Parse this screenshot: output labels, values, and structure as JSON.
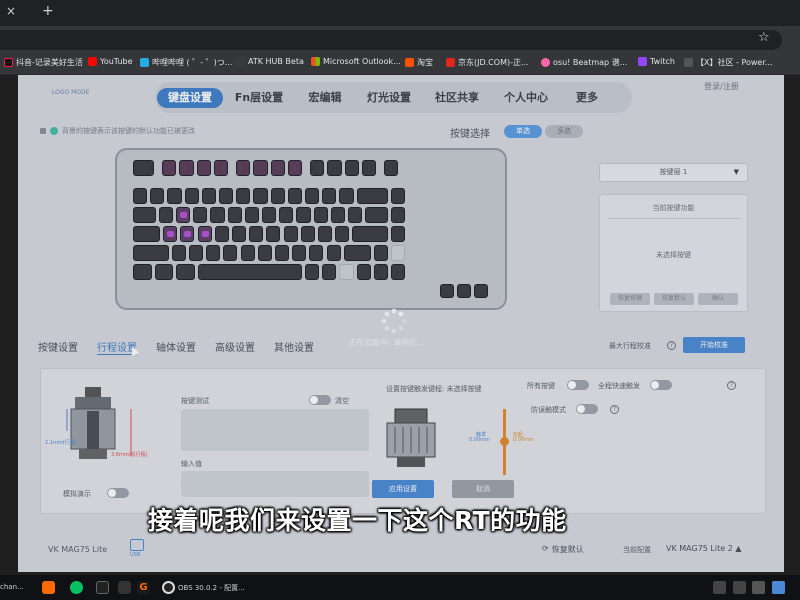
{
  "browser": {
    "tab_close": "×",
    "tab_new": "+",
    "star": "☆",
    "bookmarks": [
      {
        "label": "抖音-记录美好生活",
        "color": "#111111"
      },
      {
        "label": "YouTube",
        "color": "#ff0000"
      },
      {
        "label": "哔哩哔哩 ( ゜- ゜)つ...",
        "color": "#23ade5"
      },
      {
        "label": "ATK HUB Beta",
        "color": "#3a3a3a"
      },
      {
        "label": "Microsoft Outlook...",
        "color": "#f25022"
      },
      {
        "label": "淘宝",
        "color": "#ff5000"
      },
      {
        "label": "京东(JD.COM)-正...",
        "color": "#e1251b"
      },
      {
        "label": "osu! Beatmap 谱...",
        "color": "#ff66aa"
      },
      {
        "label": "Twitch",
        "color": "#9146ff"
      },
      {
        "label": "【X】社区 - Power...",
        "color": "#555555"
      }
    ]
  },
  "site": {
    "logo": "LOGO MODE",
    "nav": [
      "键盘设置",
      "Fn层设置",
      "宏编辑",
      "灯光设置",
      "社区共享",
      "个人中心",
      "更多"
    ],
    "login": "登录/注册",
    "tip": "背景的按键表示该按键的默认功能已被更改",
    "key_select": {
      "label": "按键选择",
      "on": "单选",
      "off": "多选"
    },
    "layer_select": "按键层 1",
    "fn_panel": {
      "title": "当前按键功能",
      "empty": "未选择按键",
      "buttons": [
        "恢复按键",
        "恢复默认",
        "确认"
      ]
    },
    "loading": "正在加载中, 请稍后...",
    "subtabs": [
      "按键设置",
      "行程设置",
      "轴体设置",
      "高级设置",
      "其他设置"
    ],
    "calibrate": {
      "label": "最大行程校准",
      "button": "开始校准"
    },
    "travel": {
      "dim_left": "2.1mm(行程)",
      "dim_right": "3.8mm(总行程)",
      "test_label": "按键测试",
      "clear_label": "清空",
      "input_label": "输入值",
      "sim_label": "模拟演示",
      "trigger_label": "设置按键触发键程: 未选择按键",
      "all_keys": "所有按键",
      "rapid_trigger": "全程快速触发",
      "anti_shake": "防误触模式",
      "slider_left_top": "触发",
      "slider_left_bottom": "0.00mm",
      "slider_right_top": "抬起",
      "slider_right_bottom": "0.00mm",
      "apply": "应用设置",
      "cancel": "取消"
    },
    "footer": {
      "device": "VK MAG75 Lite",
      "usb": "USB",
      "restore": "恢复默认",
      "current_config": "当前配置",
      "device_select": "VK MAG75 Lite 2 ▲"
    }
  },
  "subtitle": "接着呢我们来设置一下这个RT的功能",
  "taskbar": {
    "left_text": "chan...",
    "obs": "OBS 30.0.2 - 配置..."
  },
  "colors": {
    "accent": "#3f7ec9",
    "key_light": "#b552d6",
    "slider": "#e38a2b"
  }
}
